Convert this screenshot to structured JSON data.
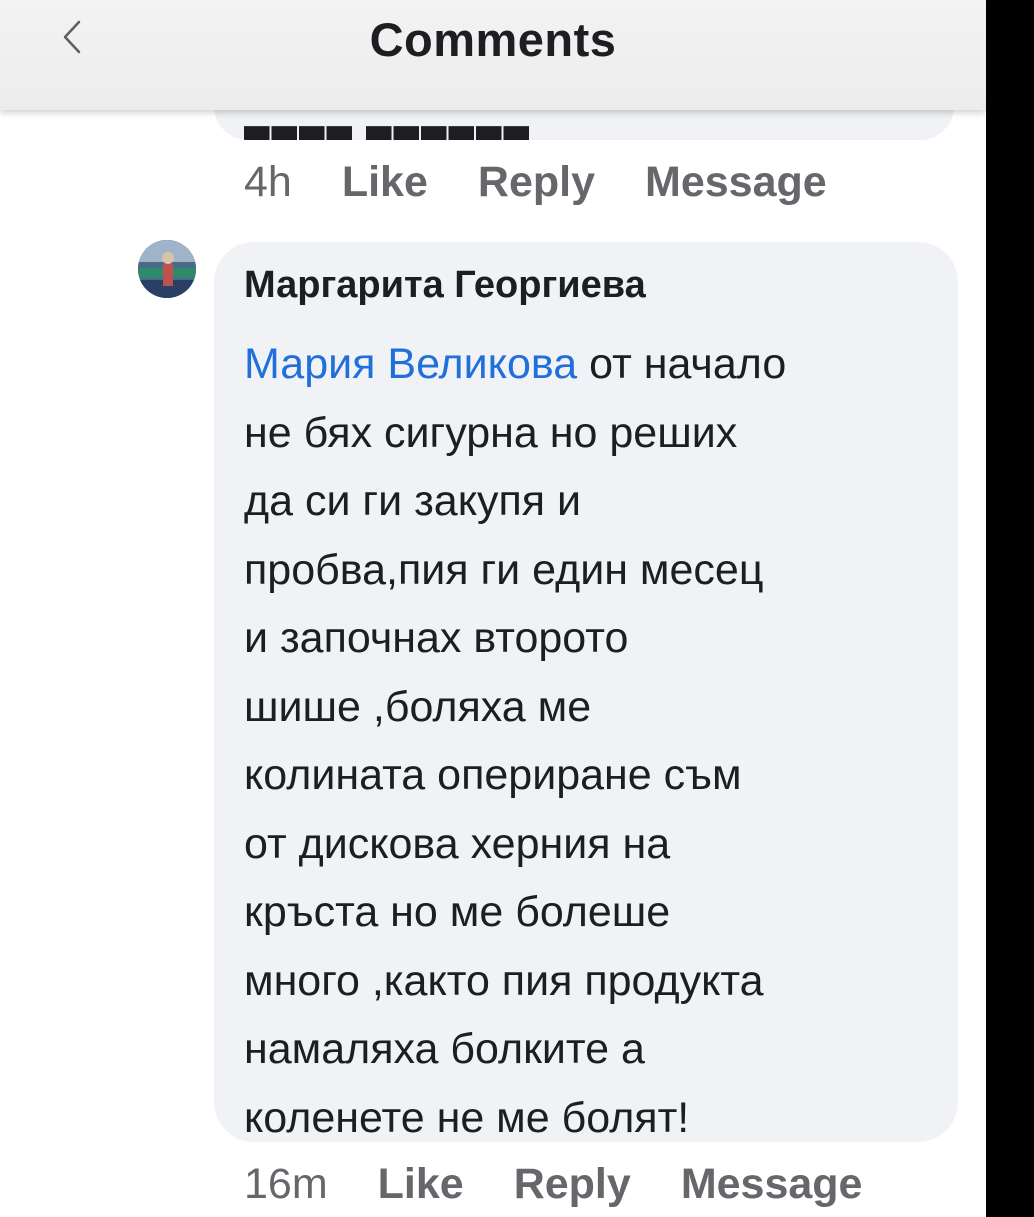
{
  "header": {
    "title": "Comments",
    "back_icon": "chevron-left-icon"
  },
  "previous_comment": {
    "time": "4h",
    "like_label": "Like",
    "reply_label": "Reply",
    "message_label": "Message"
  },
  "comment": {
    "author": "Маргарита Георгиева",
    "mention": "Мария Великова",
    "text_lines": [
      " от начало",
      "не бях сигурна но реших",
      "да си ги закупя и",
      "пробва,пия ги един месец",
      "и започнах второто",
      "шише ,боляха  ме",
      "колината опериране съм",
      "от дискова херния на",
      "кръста но ме болеше",
      "много ,както пия продукта",
      "намаляха болките а",
      "коленете не ме болят!"
    ],
    "time": "16m",
    "like_label": "Like",
    "reply_label": "Reply",
    "message_label": "Message"
  },
  "colors": {
    "mention": "#216fdb",
    "bubble": "#f0f2f5",
    "secondary_text": "#65676b",
    "primary_text": "#1c1e21"
  }
}
